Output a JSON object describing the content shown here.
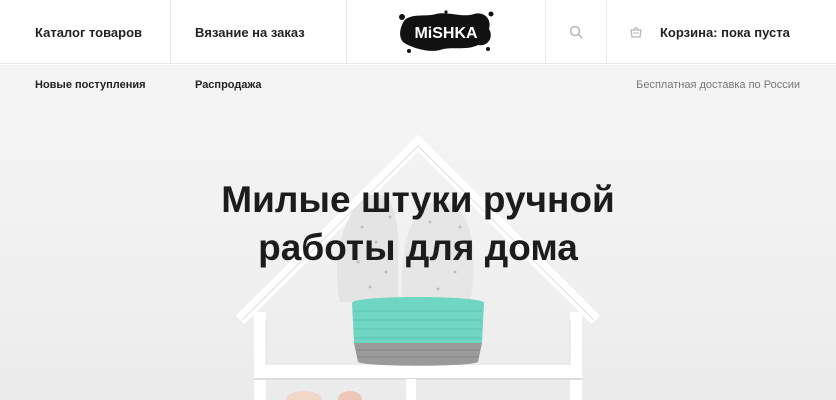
{
  "header": {
    "catalog_link": "Каталог товаров",
    "knit_link": "Вязание на заказ",
    "logo_text": "MiSHKA",
    "search_icon": "search-icon",
    "cart_icon": "cart-icon",
    "cart_label": "Корзина: пока пуста"
  },
  "subnav": {
    "new_label": "Новые поступления",
    "sale_label": "Распродажа",
    "delivery_text": "Бесплатная доставка по России"
  },
  "hero": {
    "title_line1": "Милые штуки ручной",
    "title_line2": "работы для дома"
  },
  "colors": {
    "accent_mint": "#6fd6c4",
    "basket_grey": "#9a9a9a",
    "logo_black": "#111111",
    "background": "#f4f4f4"
  }
}
